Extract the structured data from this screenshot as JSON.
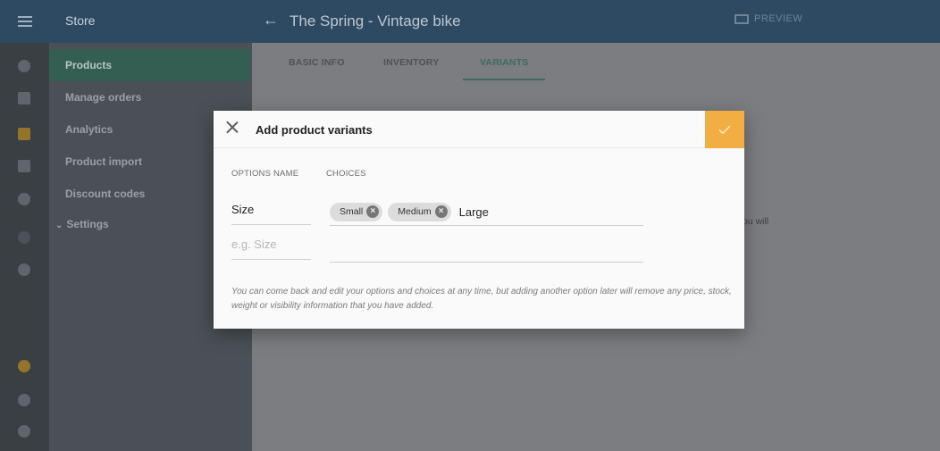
{
  "sidebar": {
    "store_label": "Store",
    "items": [
      {
        "label": "Products",
        "active": true
      },
      {
        "label": "Manage orders"
      },
      {
        "label": "Analytics"
      },
      {
        "label": "Product import"
      },
      {
        "label": "Discount codes"
      },
      {
        "label": "Settings",
        "expandable": true
      }
    ]
  },
  "header": {
    "back_icon": "arrow-left-icon",
    "title": "The Spring - Vintage bike",
    "preview_label": "PREVIEW"
  },
  "tabs": [
    {
      "label": "BASIC INFO"
    },
    {
      "label": "INVENTORY"
    },
    {
      "label": "VARIANTS",
      "active": true
    }
  ],
  "background_text": "ou will",
  "dialog": {
    "title": "Add product variants",
    "close_icon": "close-icon",
    "confirm_icon": "check-icon",
    "options_header": "OPTIONS NAME",
    "choices_header": "CHOICES",
    "rows": [
      {
        "name": "Size",
        "chips": [
          "Small",
          "Medium"
        ],
        "typed": "Large"
      },
      {
        "name_placeholder": "e.g. Size"
      }
    ],
    "note": "You can come back and edit your options and choices at any time, but adding another option later will remove any price, stock, weight or visibility information that you have added."
  },
  "colors": {
    "accent": "#f2ad43",
    "header": "#2e4a63",
    "active_tab": "#3d6b5c"
  }
}
